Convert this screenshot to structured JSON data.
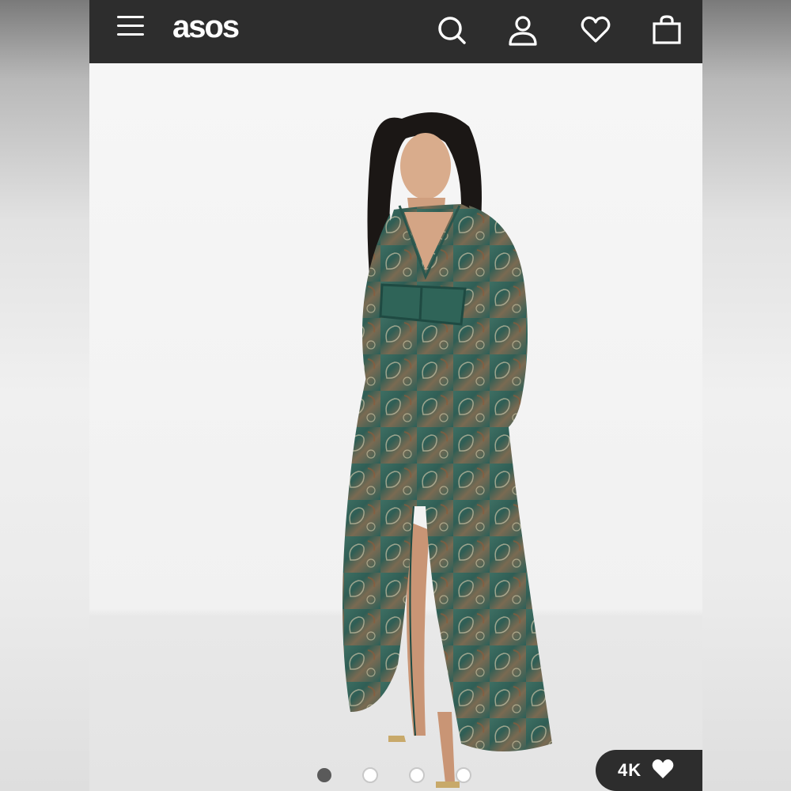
{
  "header": {
    "logo_text": "asos",
    "icons": [
      "menu-icon",
      "search-icon",
      "account-icon",
      "heart-icon",
      "bag-icon"
    ],
    "background": "#2d2d2d"
  },
  "product": {
    "image_description_icon": "product-photo",
    "carousel": {
      "total": 4,
      "active": 1
    }
  },
  "likes": {
    "count": "4K",
    "icon": "heart-filled-icon"
  }
}
